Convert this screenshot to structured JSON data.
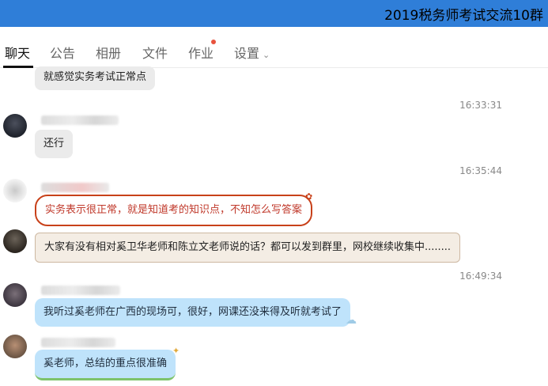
{
  "window": {
    "title": "2019税务师考试交流10群"
  },
  "tabs": [
    {
      "label": "聊天"
    },
    {
      "label": "公告"
    },
    {
      "label": "相册"
    },
    {
      "label": "文件"
    },
    {
      "label": "作业"
    },
    {
      "label": "设置"
    }
  ],
  "messages": [
    {
      "text": "就感觉实务考试正常点"
    },
    {
      "timestamp": "16:33:31"
    },
    {
      "text": "还行"
    },
    {
      "timestamp": "16:35:44"
    },
    {
      "text": "实务表示很正常，就是知道考的知识点，不知怎么写答案"
    },
    {
      "text": "大家有没有相对奚卫华老师和陈立文老师说的话？都可以发到群里，网校继续收集中........"
    },
    {
      "timestamp": "16:49:34"
    },
    {
      "text": "我听过奚老师在广西的现场可，很好，网课还没来得及听就考试了"
    },
    {
      "text": "奚老师，总结的重点很准确"
    }
  ],
  "colors": {
    "titlebar": "#2f7ed8",
    "badge_dot": "#e8533d",
    "bubble_gray": "#ebebeb",
    "bubble_blue": "#bfe3fb",
    "bubble_red_border": "#c8411a",
    "bubble_cream": "#f4ede4"
  }
}
